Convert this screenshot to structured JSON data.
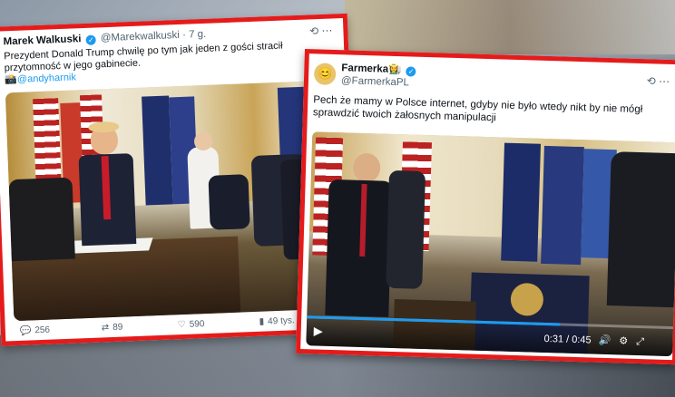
{
  "tweet1": {
    "name": "Marek Walkuski",
    "handle": "@Marekwalkuski",
    "time": "· 7 g.",
    "text": "Prezydent Donald Trump chwilę po tym jak jeden z gości stracił przytomność w jego gabinecie.",
    "mention": "@andyharnik",
    "stats": {
      "replies": "256",
      "retweets": "89",
      "likes": "590",
      "views": "49 tys."
    }
  },
  "tweet2": {
    "name": "Farmerka",
    "handle": "@FarmerkaPL",
    "text": "Pech że mamy w Polsce internet, gdyby nie było wtedy nikt by nie mógł sprawdzić twoich żałosnych manipulacji",
    "video": {
      "current": "0:31",
      "total": "0:45",
      "progress": 0.69
    }
  },
  "colors": {
    "frame": "#e51b1b",
    "link": "#1d9bf0"
  }
}
